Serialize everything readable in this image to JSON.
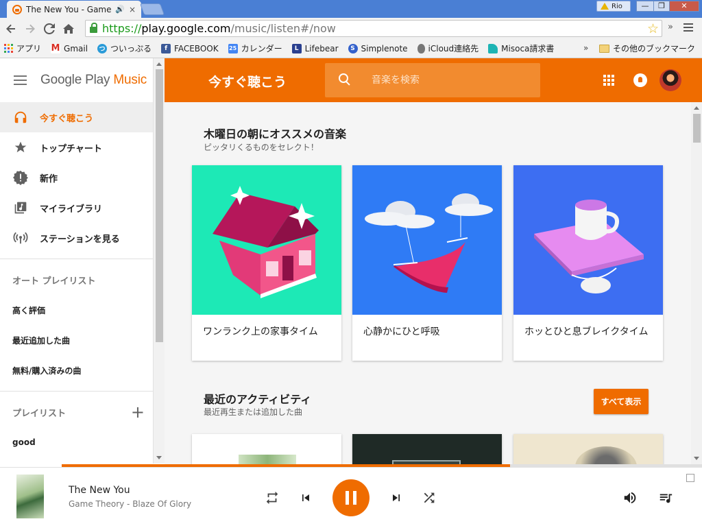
{
  "browser": {
    "tab_title": "The New You - Game",
    "tab_close": "×",
    "profile_name": "Rio",
    "win_min": "—",
    "win_max": "❐",
    "win_close": "✕",
    "url_scheme": "https://",
    "url_host": "play.google.com",
    "url_path": "/music/listen#/now",
    "toolbar_more": "»",
    "bookmarks": [
      {
        "label": "アプリ",
        "icon": "apps-grid-icon"
      },
      {
        "label": "Gmail",
        "icon": "gmail-icon",
        "glyph": "M",
        "color": "#d93025"
      },
      {
        "label": "ついっぷる",
        "icon": "twipple-icon",
        "glyph": "つ",
        "color": "#2a9bd8"
      },
      {
        "label": "FACEBOOK",
        "icon": "facebook-icon",
        "glyph": "f",
        "color": "#3b5998"
      },
      {
        "label": "カレンダー",
        "icon": "calendar-icon",
        "glyph": "25",
        "color": "#4285f4"
      },
      {
        "label": "Lifebear",
        "icon": "lifebear-icon",
        "glyph": "L",
        "color": "#2a3f8f"
      },
      {
        "label": "Simplenote",
        "icon": "simplenote-icon",
        "glyph": "S",
        "color": "#3361cc"
      },
      {
        "label": "iCloud連絡先",
        "icon": "apple-icon",
        "glyph": "",
        "color": "#666666"
      },
      {
        "label": "Misoca請求書",
        "icon": "misoca-icon",
        "glyph": "",
        "color": "#1db4b4"
      }
    ],
    "bookmarks_more": "»",
    "other_bookmarks": "その他のブックマーク"
  },
  "app": {
    "logo_prefix": "Google Play",
    "logo_suffix": "Music",
    "page_title": "今すぐ聴こう",
    "search_placeholder": "音楽を検索",
    "accent": "#ef6c00"
  },
  "sidebar": {
    "items": [
      {
        "label": "今すぐ聴こう",
        "icon": "headphones-icon",
        "active": true
      },
      {
        "label": "トップチャート",
        "icon": "star-icon"
      },
      {
        "label": "新作",
        "icon": "new-release-icon"
      },
      {
        "label": "マイライブラリ",
        "icon": "library-music-icon"
      },
      {
        "label": "ステーションを見る",
        "icon": "radio-station-icon"
      }
    ],
    "auto_playlists_heading": "オート プレイリスト",
    "auto_playlists": [
      "高く評価",
      "最近追加した曲",
      "無料/購入済みの曲"
    ],
    "playlists_heading": "プレイリスト",
    "add_playlist": "+",
    "playlists": [
      "good"
    ]
  },
  "main": {
    "rec_title": "木曜日の朝にオススメの音楽",
    "rec_subtitle": "ピッタリくるものをセレクト！",
    "cards": [
      {
        "title": "ワンランク上の家事タイム",
        "bg": "#1de9b6"
      },
      {
        "title": "心静かにひと呼吸",
        "bg": "#2f7bf5"
      },
      {
        "title": "ホッとひと息ブレイクタイム",
        "bg": "#3d6ef2"
      }
    ],
    "activity_title": "最近のアクティビティ",
    "activity_subtitle": "最近再生または追加した曲",
    "show_all": "すべて表示"
  },
  "player": {
    "track_title": "The New You",
    "track_artist": "Game Theory - Blaze Of Glory",
    "progress": 0.7
  }
}
